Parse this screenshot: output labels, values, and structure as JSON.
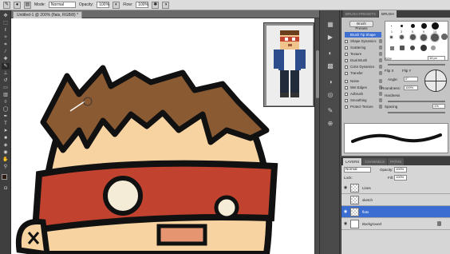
{
  "options_bar": {
    "mode_label": "Mode:",
    "mode_value": "Normal",
    "opacity_label": "Opacity:",
    "opacity_value": "100%",
    "flow_label": "Flow:",
    "flow_value": "100%"
  },
  "document": {
    "tab_title": "Untitled-1 @ 200% (flats, RGB/8) *"
  },
  "brush_panel": {
    "tabs": [
      "BRUSH PRESETS",
      "BRUSH"
    ],
    "presets_button": "Brush Presets",
    "options": [
      "Brush Tip Shape",
      "Shape Dynamics",
      "Scattering",
      "Texture",
      "Dual Brush",
      "Color Dynamics",
      "Transfer",
      "Noise",
      "Wet Edges",
      "Airbrush",
      "Smoothing",
      "Protect Texture"
    ],
    "tip_sizes": [
      "1",
      "3",
      "5",
      "9",
      "13",
      "19"
    ],
    "size_label": "Size",
    "size_value": "15 px",
    "flip_x": "Flip X",
    "flip_y": "Flip Y",
    "angle_label": "Angle:",
    "angle_value": "0°",
    "roundness_label": "Roundness:",
    "roundness_value": "100%",
    "hardness_label": "Hardness",
    "spacing_label": "Spacing",
    "spacing_value": "1%"
  },
  "layers_panel": {
    "tabs": [
      "LAYERS",
      "CHANNELS",
      "PATHS"
    ],
    "blend_mode": "Normal",
    "opacity_label": "Opacity:",
    "opacity_value": "100%",
    "lock_label": "Lock:",
    "fill_label": "Fill:",
    "fill_value": "100%",
    "layers": [
      "Lines",
      "sketch",
      "flats",
      "Background"
    ],
    "selected": "flats"
  },
  "icons": [
    "brush-icon",
    "move-icon",
    "marquee-icon",
    "lasso-icon",
    "wand-icon",
    "crop-icon",
    "eyedropper-icon",
    "heal-icon",
    "stamp-icon",
    "eraser-icon",
    "gradient-icon",
    "dodge-icon",
    "pen-icon",
    "type-icon",
    "path-select-icon",
    "shape-icon",
    "hand-icon",
    "zoom-icon",
    "eye-icon",
    "lock-icon"
  ],
  "colors": {
    "foreground": "#2b1a12",
    "background": "#ffffff",
    "accent_selection": "#3b6ed0",
    "headband_red": "#c1432f",
    "hair_brown": "#8a5a33",
    "skin": "#f7d3a1"
  }
}
